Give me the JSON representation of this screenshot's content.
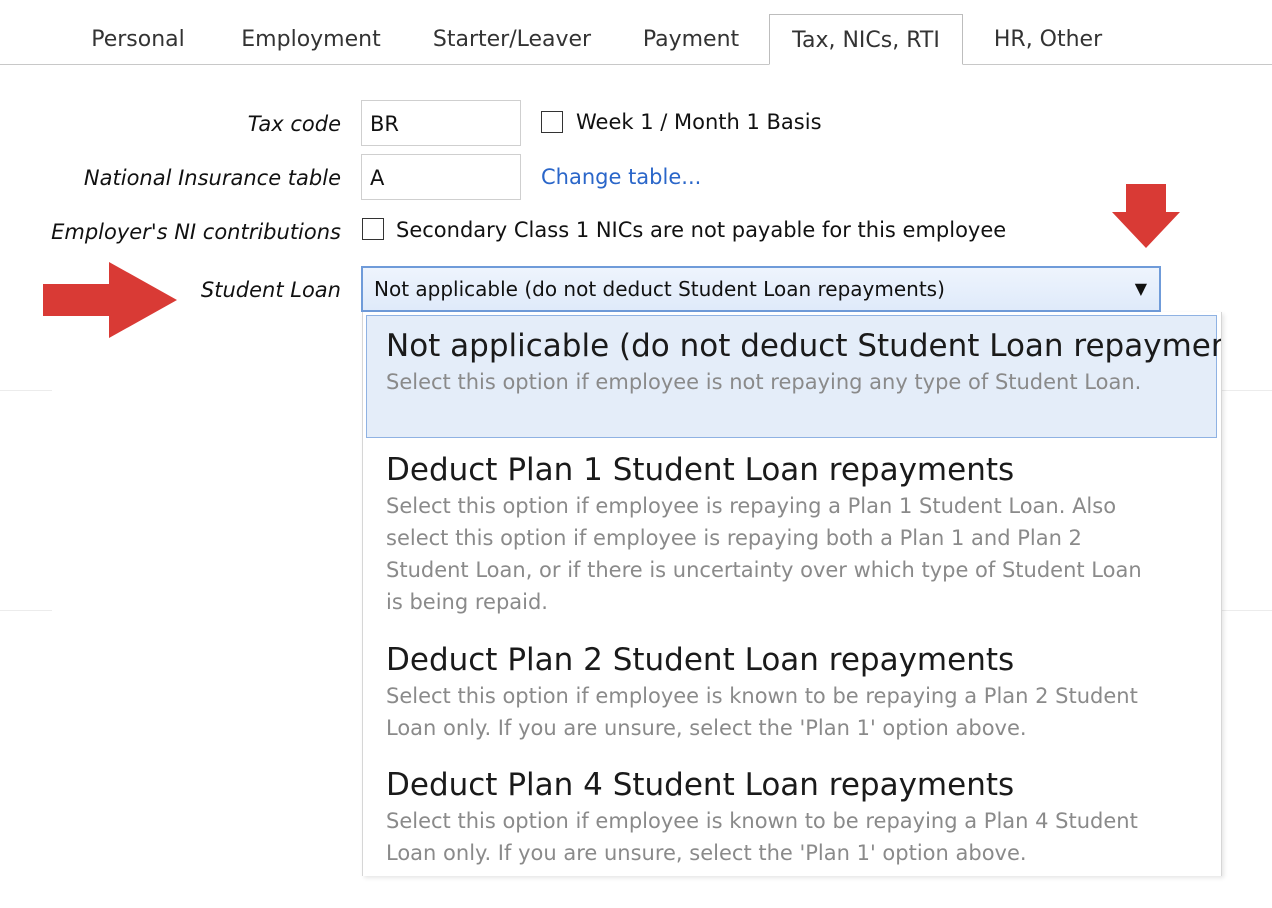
{
  "tabs": [
    {
      "label": "Personal"
    },
    {
      "label": "Employment"
    },
    {
      "label": "Starter/Leaver"
    },
    {
      "label": "Payment"
    },
    {
      "label": "Tax, NICs, RTI",
      "active": true
    },
    {
      "label": "HR, Other"
    }
  ],
  "form": {
    "tax_code_label": "Tax code",
    "tax_code_value": "BR",
    "week1_label": "Week 1 / Month 1 Basis",
    "week1_checked": false,
    "ni_table_label": "National Insurance table",
    "ni_table_value": "A",
    "change_table_link": "Change table...",
    "employer_ni_label": "Employer's NI contributions",
    "secondary_class_label": "Secondary Class 1 NICs are not payable for this employee",
    "secondary_class_checked": false,
    "student_loan_label": "Student Loan",
    "student_loan_selected": "Not applicable (do not deduct Student Loan repayments)"
  },
  "dropdown": {
    "options": [
      {
        "title": "Not applicable (do not deduct Student Loan repayments)",
        "desc": "Select this option if employee is not repaying any type of Student Loan.",
        "selected": true
      },
      {
        "title": "Deduct Plan 1 Student Loan repayments",
        "desc": "Select this option if employee is repaying a Plan 1 Student Loan. Also select this option if employee is repaying both a Plan 1 and Plan 2 Student Loan, or if there is uncertainty over which type of Student Loan is being repaid."
      },
      {
        "title": "Deduct Plan 2 Student Loan repayments",
        "desc": "Select this option if employee is known to be repaying a Plan 2 Student Loan only. If you are unsure, select the 'Plan 1' option above."
      },
      {
        "title": "Deduct Plan 4 Student Loan repayments",
        "desc": "Select this option if employee is known to be repaying a Plan 4 Student Loan only. If you are unsure, select the 'Plan 1' option above."
      }
    ]
  },
  "icons": {
    "dropdown_caret": "▼",
    "annotation_arrow_color": "#d93a35"
  }
}
